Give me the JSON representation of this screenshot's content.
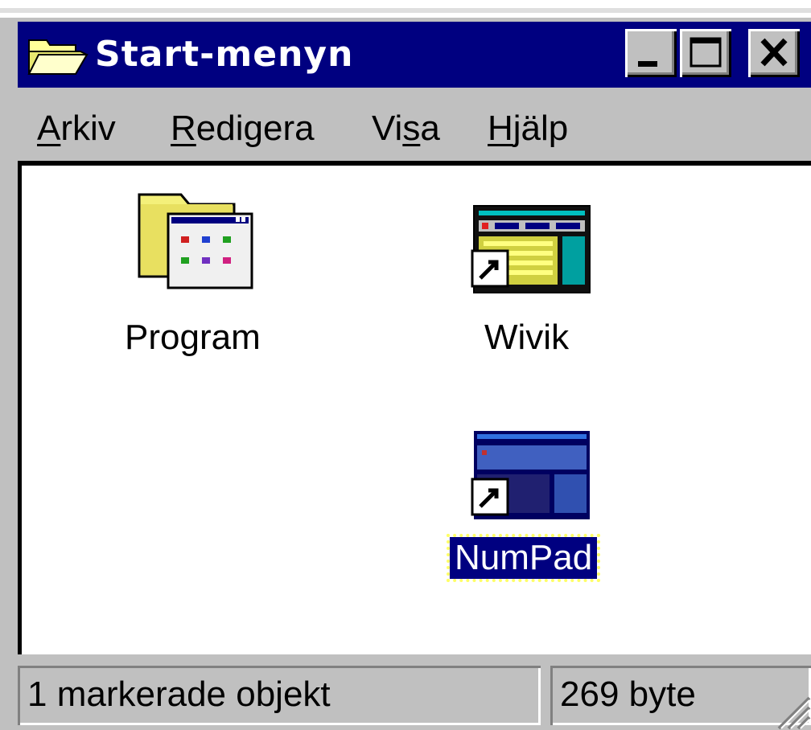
{
  "window": {
    "title": "Start-menyn",
    "title_icon": "open-folder-icon",
    "controls": {
      "minimize": "minimize-icon",
      "maximize": "maximize-icon",
      "close": "close-icon"
    },
    "colors": {
      "titlebar": "#000080",
      "face": "#c0c0c0",
      "selection": "#000080"
    }
  },
  "menu": [
    {
      "access": "A",
      "rest": "rkiv"
    },
    {
      "access": "R",
      "rest": "edigera"
    },
    {
      "pre": "Vi",
      "access": "s",
      "rest": "a"
    },
    {
      "access": "H",
      "rest": "jälp"
    }
  ],
  "items": [
    {
      "label": "Program",
      "icon": "program-folder-icon",
      "selected": false
    },
    {
      "label": "Wivik",
      "icon": "keyboard-shortcut-icon",
      "selected": false
    },
    {
      "label": "NumPad",
      "icon": "numpad-shortcut-icon",
      "selected": true
    }
  ],
  "status": {
    "selection_text": "1 markerade objekt",
    "size_text": "269 byte"
  }
}
